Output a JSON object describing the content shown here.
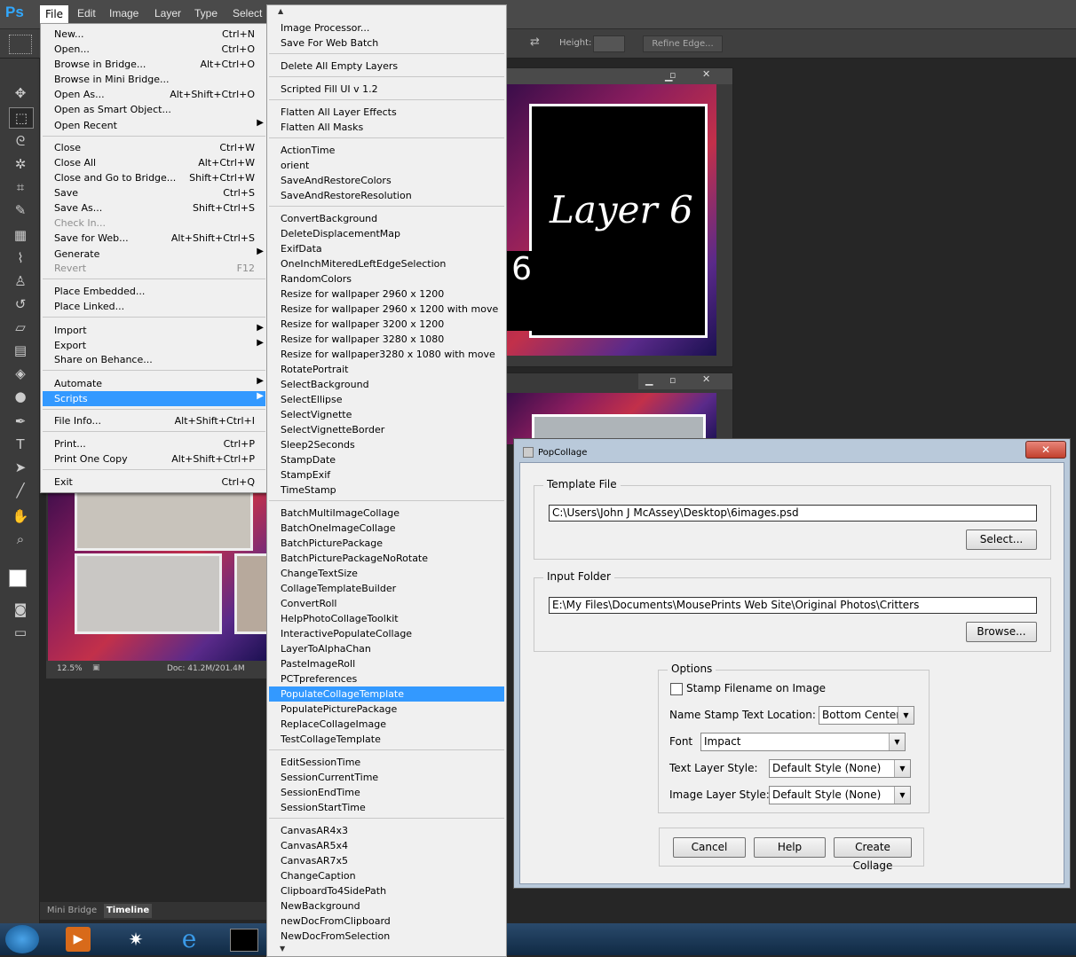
{
  "app": {
    "logo": "Ps"
  },
  "menubar": {
    "items": [
      "File",
      "Edit",
      "Image",
      "Layer",
      "Type",
      "Select"
    ]
  },
  "optionsbar": {
    "height_label": "Height:",
    "refine_edge": "Refine Edge..."
  },
  "document": {
    "canvas_text_1": "Layer  6",
    "canvas_text_2": "6",
    "zoom": "12.5%",
    "doc_size": "Doc: 41.2M/201.4M"
  },
  "bottom_tabs": [
    "Mini Bridge",
    "Timeline"
  ],
  "file_menu": {
    "items": [
      {
        "label": "New...",
        "shortcut": "Ctrl+N"
      },
      {
        "label": "Open...",
        "shortcut": "Ctrl+O"
      },
      {
        "label": "Browse in Bridge...",
        "shortcut": "Alt+Ctrl+O"
      },
      {
        "label": "Browse in Mini Bridge...",
        "shortcut": ""
      },
      {
        "label": "Open As...",
        "shortcut": "Alt+Shift+Ctrl+O"
      },
      {
        "label": "Open as Smart Object...",
        "shortcut": ""
      },
      {
        "label": "Open Recent",
        "shortcut": ""
      },
      {
        "label": "Close",
        "shortcut": "Ctrl+W"
      },
      {
        "label": "Close All",
        "shortcut": "Alt+Ctrl+W"
      },
      {
        "label": "Close and Go to Bridge...",
        "shortcut": "Shift+Ctrl+W"
      },
      {
        "label": "Save",
        "shortcut": "Ctrl+S"
      },
      {
        "label": "Save As...",
        "shortcut": "Shift+Ctrl+S"
      },
      {
        "label": "Check In...",
        "shortcut": ""
      },
      {
        "label": "Save for Web...",
        "shortcut": "Alt+Shift+Ctrl+S"
      },
      {
        "label": "Generate",
        "shortcut": ""
      },
      {
        "label": "Revert",
        "shortcut": "F12"
      },
      {
        "label": "Place Embedded...",
        "shortcut": ""
      },
      {
        "label": "Place Linked...",
        "shortcut": ""
      },
      {
        "label": "Import",
        "shortcut": ""
      },
      {
        "label": "Export",
        "shortcut": ""
      },
      {
        "label": "Share on Behance...",
        "shortcut": ""
      },
      {
        "label": "Automate",
        "shortcut": ""
      },
      {
        "label": "Scripts",
        "shortcut": ""
      },
      {
        "label": "File Info...",
        "shortcut": "Alt+Shift+Ctrl+I"
      },
      {
        "label": "Print...",
        "shortcut": "Ctrl+P"
      },
      {
        "label": "Print One Copy",
        "shortcut": "Alt+Shift+Ctrl+P"
      },
      {
        "label": "Exit",
        "shortcut": "Ctrl+Q"
      }
    ]
  },
  "scripts_menu": {
    "items": [
      "Image Processor...",
      "Save For Web Batch",
      "Delete All Empty Layers",
      "Scripted Fill UI v 1.2",
      "Flatten All Layer Effects",
      "Flatten All Masks",
      "ActionTime",
      "orient",
      "SaveAndRestoreColors",
      "SaveAndRestoreResolution",
      "ConvertBackground",
      "DeleteDisplacementMap",
      "ExifData",
      "OneInchMiteredLeftEdgeSelection",
      "RandomColors",
      "Resize for wallpaper 2960 x 1200",
      "Resize for wallpaper 2960 x 1200 with move",
      "Resize for wallpaper 3200 x 1200",
      "Resize for wallpaper 3280 x 1080",
      "Resize for wallpaper3280 x 1080 with move",
      "RotatePortrait",
      "SelectBackground",
      "SelectEllipse",
      "SelectVignette",
      "SelectVignetteBorder",
      "Sleep2Seconds",
      "StampDate",
      "StampExif",
      "TimeStamp",
      "BatchMultiImageCollage",
      "BatchOneImageCollage",
      "BatchPicturePackage",
      "BatchPicturePackageNoRotate",
      "ChangeTextSize",
      "CollageTemplateBuilder",
      "ConvertRoll",
      "HelpPhotoCollageToolkit",
      "InteractivePopulateCollage",
      "LayerToAlphaChan",
      "PasteImageRoll",
      "PCTpreferences",
      "PopulateCollageTemplate",
      "PopulatePicturePackage",
      "ReplaceCollageImage",
      "TestCollageTemplate",
      "EditSessionTime",
      "SessionCurrentTime",
      "SessionEndTime",
      "SessionStartTime",
      "CanvasAR4x3",
      "CanvasAR5x4",
      "CanvasAR7x5",
      "ChangeCaption",
      "ClipboardTo4SidePath",
      "NewBackground",
      "newDocFromClipboard",
      "NewDocFromSelection"
    ]
  },
  "dialog": {
    "title": "PopCollage",
    "template_group": "Template File",
    "template_path": "C:\\Users\\John J McAssey\\Desktop\\6images.psd",
    "select_btn": "Select...",
    "input_group": "Input Folder",
    "input_path": "E:\\My Files\\Documents\\MousePrints Web Site\\Original Photos\\Critters",
    "browse_btn": "Browse...",
    "options_group": "Options",
    "stamp_checkbox": "Stamp Filename on Image",
    "name_stamp_label": "Name Stamp  Text  Location:",
    "name_stamp_value": "Bottom Center",
    "font_label": "Font",
    "font_value": "Impact",
    "text_style_label": "Text Layer Style:",
    "text_style_value": "Default Style (None)",
    "image_style_label": "Image Layer Style:",
    "image_style_value": "Default Style (None)",
    "cancel_btn": "Cancel",
    "help_btn": "Help",
    "create_btn": "Create Collage"
  },
  "colors": {
    "accent": "#3399ff",
    "ps_blue": "#31a8ff"
  }
}
